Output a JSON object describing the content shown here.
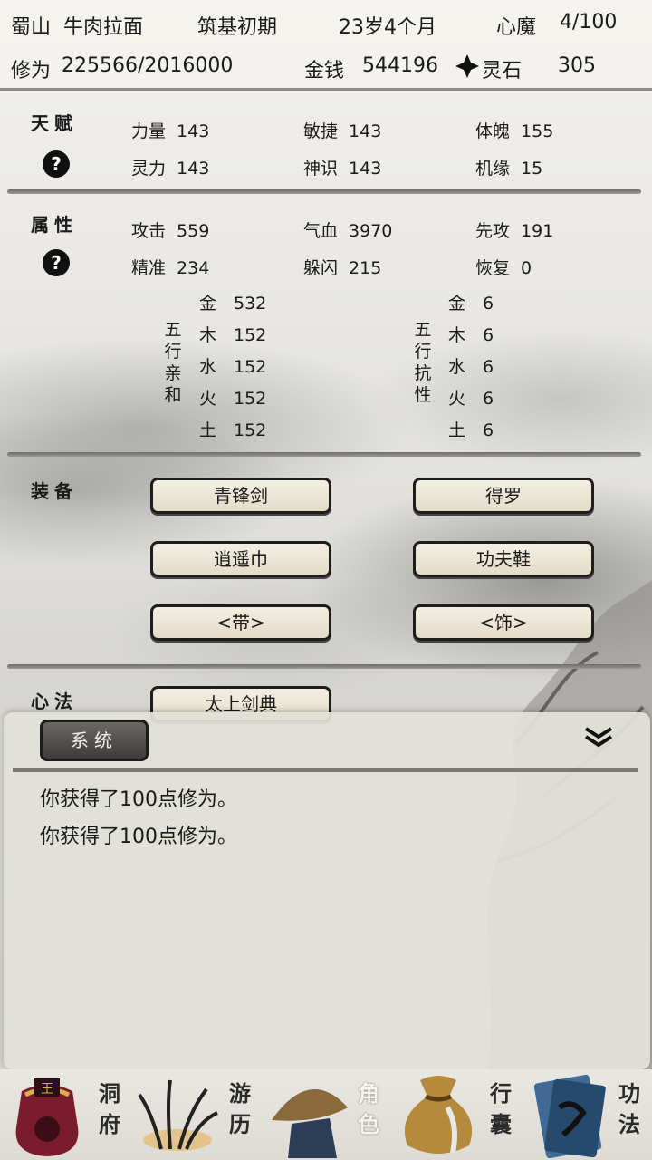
{
  "header": {
    "sect": "蜀山",
    "name": "牛肉拉面",
    "realm": "筑基初期",
    "age": "23岁4个月",
    "xinmo_label": "心魔",
    "xinmo_value": "4/100",
    "xiuwei_label": "修为",
    "xiuwei_value": "225566/2016000",
    "money_label": "金钱",
    "money_value": "544196",
    "lingshi_label": "灵石",
    "lingshi_value": "305"
  },
  "talent": {
    "title": "天赋",
    "help": "?",
    "stats": [
      {
        "k": "力量",
        "v": "143"
      },
      {
        "k": "敏捷",
        "v": "143"
      },
      {
        "k": "体魄",
        "v": "155"
      },
      {
        "k": "灵力",
        "v": "143"
      },
      {
        "k": "神识",
        "v": "143"
      },
      {
        "k": "机缘",
        "v": "15"
      }
    ]
  },
  "attributes": {
    "title": "属性",
    "help": "?",
    "stats": [
      {
        "k": "攻击",
        "v": "559"
      },
      {
        "k": "气血",
        "v": "3970"
      },
      {
        "k": "先攻",
        "v": "191"
      },
      {
        "k": "精准",
        "v": "234"
      },
      {
        "k": "躲闪",
        "v": "215"
      },
      {
        "k": "恢复",
        "v": "0"
      }
    ],
    "affinity_label": "五行亲和",
    "affinity": [
      {
        "k": "金",
        "v": "532"
      },
      {
        "k": "木",
        "v": "152"
      },
      {
        "k": "水",
        "v": "152"
      },
      {
        "k": "火",
        "v": "152"
      },
      {
        "k": "土",
        "v": "152"
      }
    ],
    "resist_label": "五行抗性",
    "resist": [
      {
        "k": "金",
        "v": "6"
      },
      {
        "k": "木",
        "v": "6"
      },
      {
        "k": "水",
        "v": "6"
      },
      {
        "k": "火",
        "v": "6"
      },
      {
        "k": "土",
        "v": "6"
      }
    ]
  },
  "equipment": {
    "title": "装备",
    "slots": [
      "青锋剑",
      "得罗",
      "逍遥巾",
      "功夫鞋",
      "<带>",
      "<饰>"
    ]
  },
  "xinfa": {
    "title": "心法",
    "items": [
      "太上剑典"
    ]
  },
  "log": {
    "tab": "系统",
    "messages": [
      "你获得了100点修为。",
      "你获得了100点修为。"
    ]
  },
  "nav": [
    {
      "label": "洞府",
      "icon": "cave-bag-icon"
    },
    {
      "label": "游历",
      "icon": "grass-icon"
    },
    {
      "label": "角色",
      "icon": "straw-hat-icon"
    },
    {
      "label": "行囊",
      "icon": "pouch-icon"
    },
    {
      "label": "功法",
      "icon": "book-icon"
    }
  ],
  "colors": {
    "ink": "#1a1a1a",
    "button_bg": "#ebe5d4",
    "nav_bag": "#7a1c2c"
  }
}
